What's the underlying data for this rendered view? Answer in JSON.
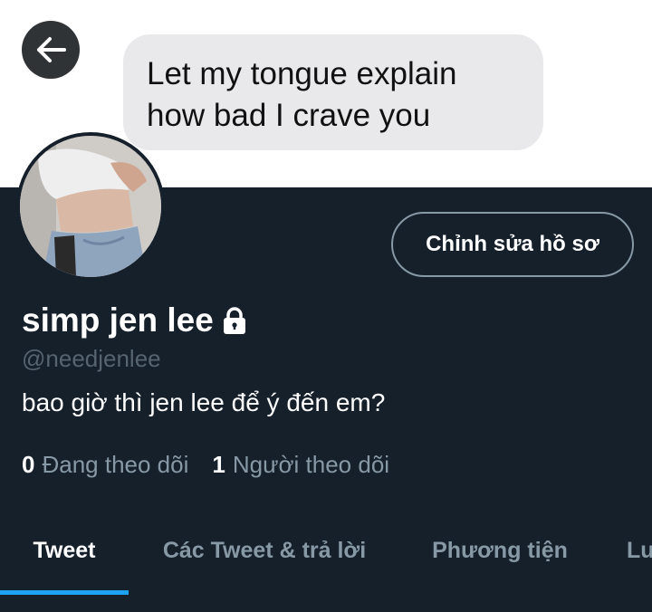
{
  "header": {
    "back_button_icon": "arrow-left-icon",
    "message_bubble": {
      "line1": "Let my tongue explain",
      "line2": "how bad I crave you"
    }
  },
  "profile": {
    "edit_button_label": "Chỉnh sửa hồ sơ",
    "display_name": "simp jen lee",
    "lock_icon": "lock-icon",
    "handle": "@needjenlee",
    "bio": "bao giờ thì jen lee để ý đến em?",
    "following_count": "0",
    "following_label": "Đang theo dõi",
    "followers_count": "1",
    "followers_label": "Người theo dõi"
  },
  "tabs": [
    {
      "label": "Tweet",
      "active": true
    },
    {
      "label": "Các Tweet & trả lời",
      "active": false
    },
    {
      "label": "Phương tiện",
      "active": false
    },
    {
      "label": "Lư",
      "active": false
    }
  ],
  "colors": {
    "background": "#15202b",
    "accent": "#1da1f2",
    "secondary_text": "#8899a6",
    "bubble": "#e9e9eb"
  }
}
